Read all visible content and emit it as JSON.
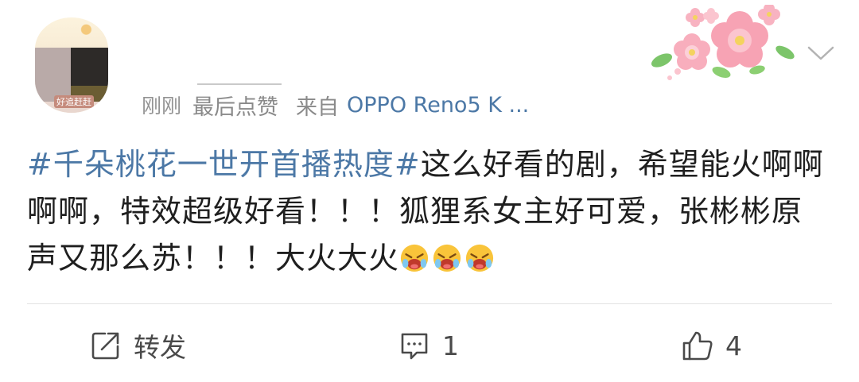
{
  "post": {
    "avatar_tag": "好追赶赶",
    "meta": {
      "time": "刚刚",
      "last_liked": "最后点赞",
      "from_label": "来自",
      "device": "OPPO Reno5 K ..."
    },
    "content": {
      "topic": "#千朵桃花一世开首播热度#",
      "text": "这么好看的剧，希望能火啊啊啊啊，特效超级好看！！！狐狸系女主好可爱，张彬彬原声又那么苏！！！大火大火",
      "emojis": [
        "crying-face-emoji",
        "crying-face-emoji",
        "crying-face-emoji"
      ]
    },
    "actions": {
      "repost_label": "转发",
      "comment_count": "1",
      "like_count": "4"
    },
    "colors": {
      "link": "#4c78a6",
      "meta_gray": "#8a8a8a",
      "text": "#1f1f1f",
      "background": "#ffffff"
    },
    "icons": {
      "decoration": "peach-blossom-icon",
      "menu": "chevron-down-icon",
      "repost": "repost-icon",
      "comment": "comment-icon",
      "like": "thumbs-up-icon"
    }
  }
}
